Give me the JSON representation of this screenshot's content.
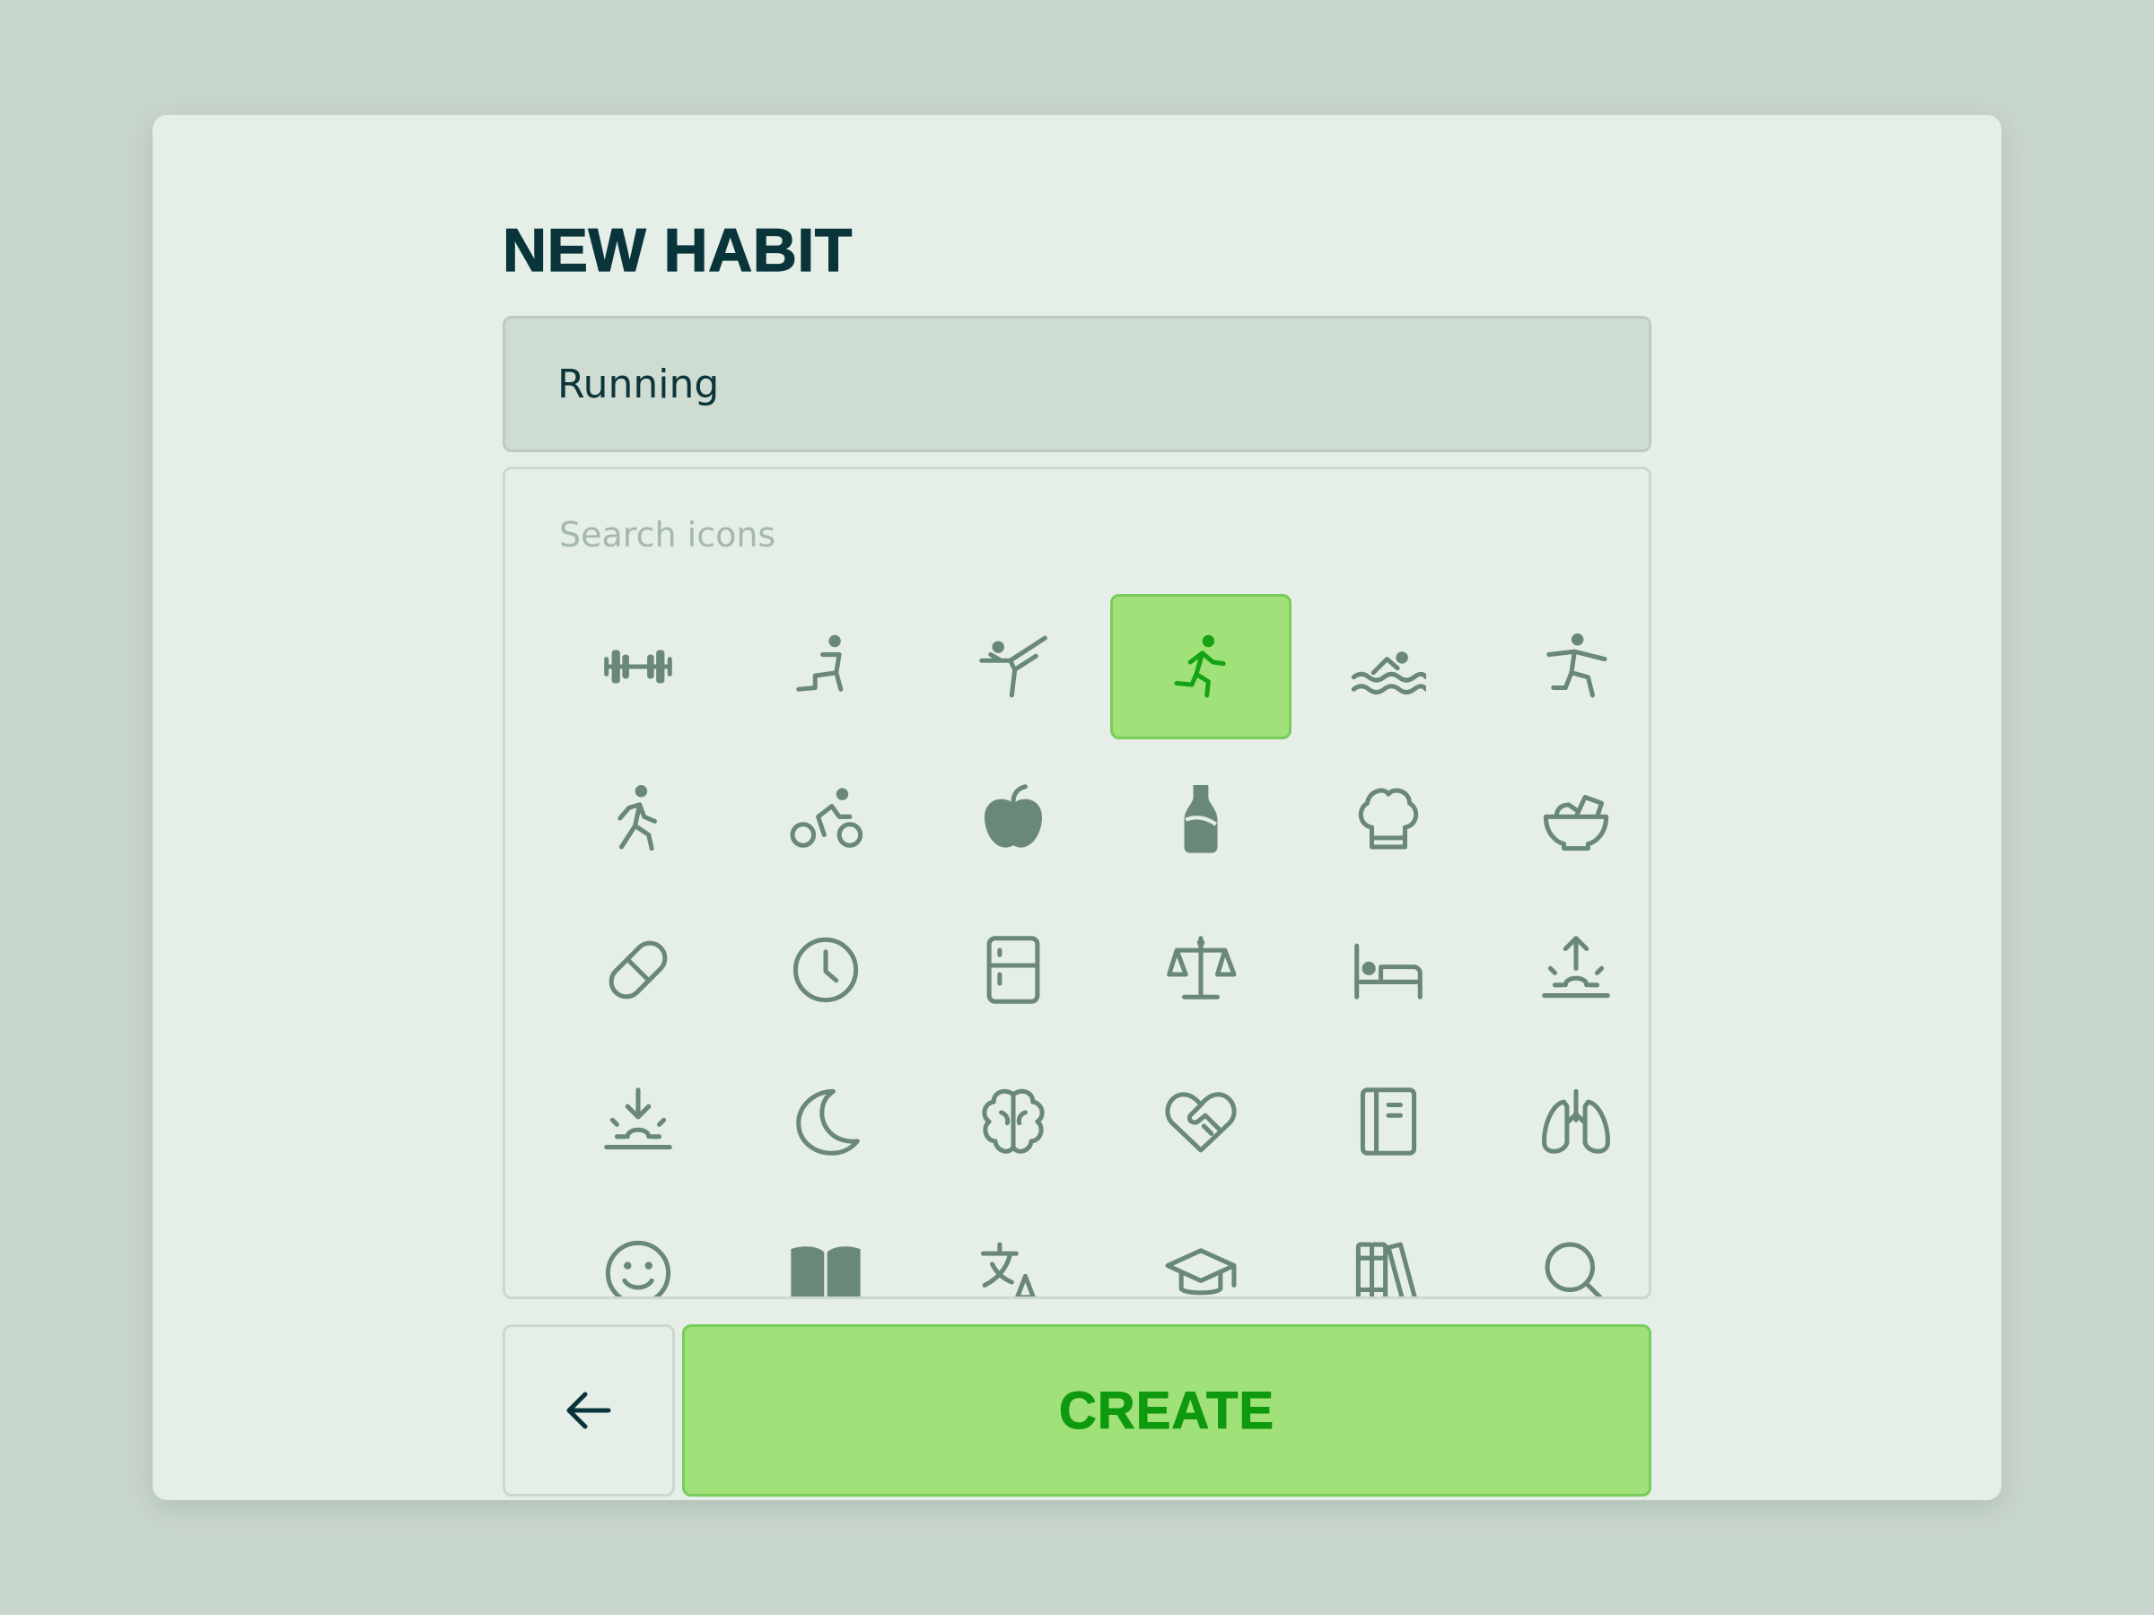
{
  "form": {
    "title": "NEW HABIT",
    "name_value": "Running",
    "search_placeholder": "Search icons"
  },
  "icon_grid": {
    "selected_icon": "running",
    "icons": [
      "dumbbell",
      "stretching",
      "martial-arts",
      "running",
      "swimming",
      "jogging",
      "walking",
      "cycling",
      "apple",
      "bottle",
      "chef-hat",
      "salad-bowl",
      "pill",
      "clock",
      "fridge",
      "scale",
      "bed",
      "sunrise",
      "sunset",
      "moon",
      "brain",
      "heart-handshake",
      "notebook",
      "lungs",
      "smile",
      "book",
      "translate",
      "graduation-cap",
      "books",
      "search"
    ]
  },
  "actions": {
    "back_icon": "arrow-left-icon",
    "create_label": "CREATE"
  },
  "colors": {
    "accent": "#a0e17a",
    "accent_text": "#0f990f",
    "icon": "#6a8878",
    "title": "#08343a"
  }
}
